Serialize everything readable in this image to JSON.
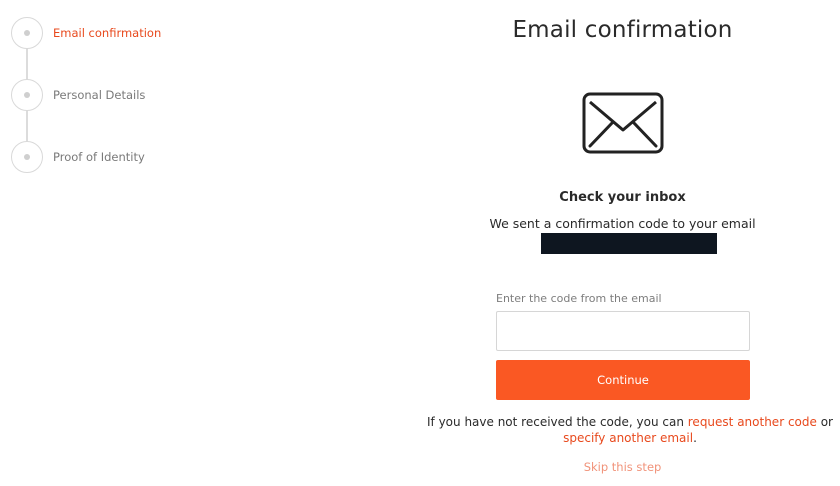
{
  "stepper": {
    "steps": [
      {
        "label": "Email confirmation",
        "active": true
      },
      {
        "label": "Personal Details",
        "active": false
      },
      {
        "label": "Proof of Identity",
        "active": false
      }
    ]
  },
  "main": {
    "title": "Email confirmation",
    "icon": "envelope-icon",
    "inbox_title": "Check your inbox",
    "sent_text": "We sent a confirmation code to your email",
    "code_field": {
      "label": "Enter the code from the email",
      "value": "",
      "placeholder": ""
    },
    "continue_label": "Continue",
    "resend": {
      "prefix": "If you have not received the code, you can ",
      "request_link": "request another code",
      "middle": " or ",
      "specify_link": "specify another email",
      "suffix": "."
    },
    "skip_label": "Skip this step"
  },
  "colors": {
    "accent": "#fa5823",
    "active_step": "#e8491d",
    "skip_link": "#f1937a"
  }
}
